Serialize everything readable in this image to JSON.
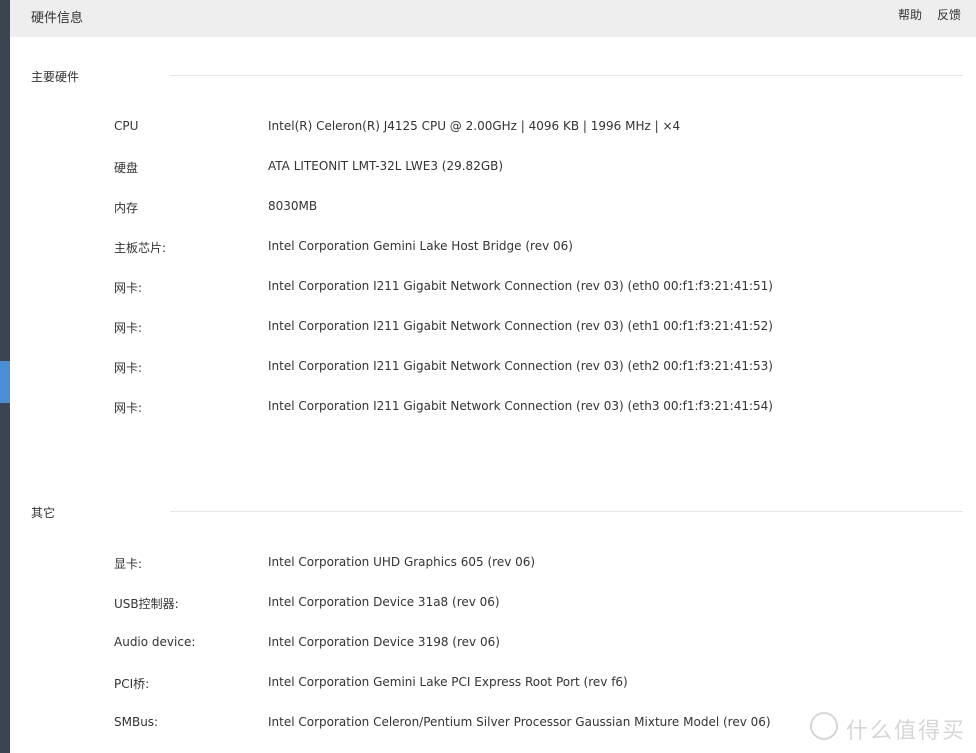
{
  "header": {
    "title": "硬件信息",
    "help_label": "帮助",
    "feedback_label": "反馈"
  },
  "main_hardware": {
    "title": "主要硬件",
    "rows": [
      {
        "label": "CPU",
        "value": "Intel(R) Celeron(R) J4125 CPU @ 2.00GHz | 4096 KB | 1996 MHz | ×4"
      },
      {
        "label": "硬盘",
        "value": "ATA LITEONIT LMT-32L LWE3 (29.82GB)"
      },
      {
        "label": "内存",
        "value": "8030MB"
      },
      {
        "label": "主板芯片:",
        "value": "Intel Corporation Gemini Lake Host Bridge (rev 06)"
      },
      {
        "label": "网卡:",
        "value": "Intel Corporation I211 Gigabit Network Connection (rev 03) (eth0 00:f1:f3:21:41:51)"
      },
      {
        "label": "网卡:",
        "value": "Intel Corporation I211 Gigabit Network Connection (rev 03) (eth1 00:f1:f3:21:41:52)"
      },
      {
        "label": "网卡:",
        "value": "Intel Corporation I211 Gigabit Network Connection (rev 03) (eth2 00:f1:f3:21:41:53)"
      },
      {
        "label": "网卡:",
        "value": "Intel Corporation I211 Gigabit Network Connection (rev 03) (eth3 00:f1:f3:21:41:54)"
      }
    ]
  },
  "other_hardware": {
    "title": "其它",
    "rows": [
      {
        "label": "显卡:",
        "value": "Intel Corporation UHD Graphics 605 (rev 06)"
      },
      {
        "label": "USB控制器:",
        "value": "Intel Corporation Device 31a8 (rev 06)"
      },
      {
        "label": "Audio device:",
        "value": "Intel Corporation Device 3198 (rev 06)"
      },
      {
        "label": "PCI桥:",
        "value": "Intel Corporation Gemini Lake PCI Express Root Port (rev f6)"
      },
      {
        "label": "SMBus:",
        "value": "Intel Corporation Celeron/Pentium Silver Processor Gaussian Mixture Model (rev 06)"
      }
    ]
  },
  "watermark": {
    "text": "什么值得买"
  },
  "colors": {
    "sidebar": "#3b4552",
    "sidebar_active": "#4a8fd6",
    "header_bg": "#eeeeee"
  }
}
